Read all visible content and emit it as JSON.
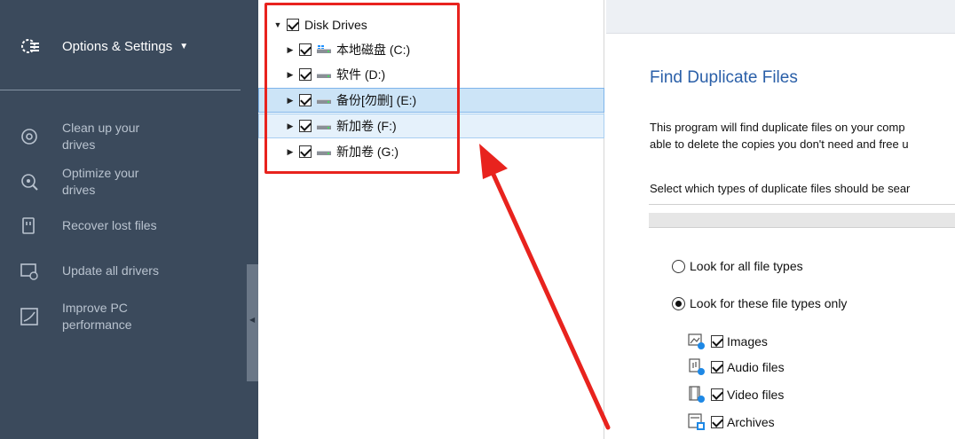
{
  "sidebar": {
    "options_label": "Options & Settings",
    "nav": [
      {
        "label": "Clean up your\ndrives",
        "icon": "disc-icon"
      },
      {
        "label": "Optimize your\ndrives",
        "icon": "optimize-icon"
      },
      {
        "label": "Recover lost files",
        "icon": "recover-file-icon"
      },
      {
        "label": "Update all drivers",
        "icon": "update-drivers-icon"
      },
      {
        "label": "Improve PC\nperformance",
        "icon": "performance-icon"
      }
    ]
  },
  "tree": {
    "root_label": "Disk Drives",
    "drives": [
      {
        "label": "本地磁盘 (C:)",
        "checked": true,
        "system": true
      },
      {
        "label": "软件 (D:)",
        "checked": true,
        "system": false
      },
      {
        "label": "备份[勿删] (E:)",
        "checked": true,
        "system": false
      },
      {
        "label": "新加卷 (F:)",
        "checked": true,
        "system": false
      },
      {
        "label": "新加卷 (G:)",
        "checked": true,
        "system": false
      }
    ]
  },
  "main": {
    "title": "Find Duplicate Files",
    "desc_line1": "This program will find duplicate files on your comp",
    "desc_line2": "able to delete the copies you don't need and free u",
    "select_text": "Select which types of duplicate files should be sear",
    "radio_all": "Look for all file types",
    "radio_these": "Look for these file types only",
    "file_types": [
      {
        "label": "Images",
        "checked": true,
        "icon": "image-file-icon"
      },
      {
        "label": "Audio files",
        "checked": true,
        "icon": "audio-file-icon"
      },
      {
        "label": "Video files",
        "checked": true,
        "icon": "video-file-icon"
      },
      {
        "label": "Archives",
        "checked": true,
        "icon": "archive-file-icon"
      }
    ]
  },
  "colors": {
    "sidebar_bg": "#3b4a5c",
    "title_blue": "#2a5fa8",
    "annotation_red": "#e8231e",
    "selection_bg": "#cce4f7"
  }
}
